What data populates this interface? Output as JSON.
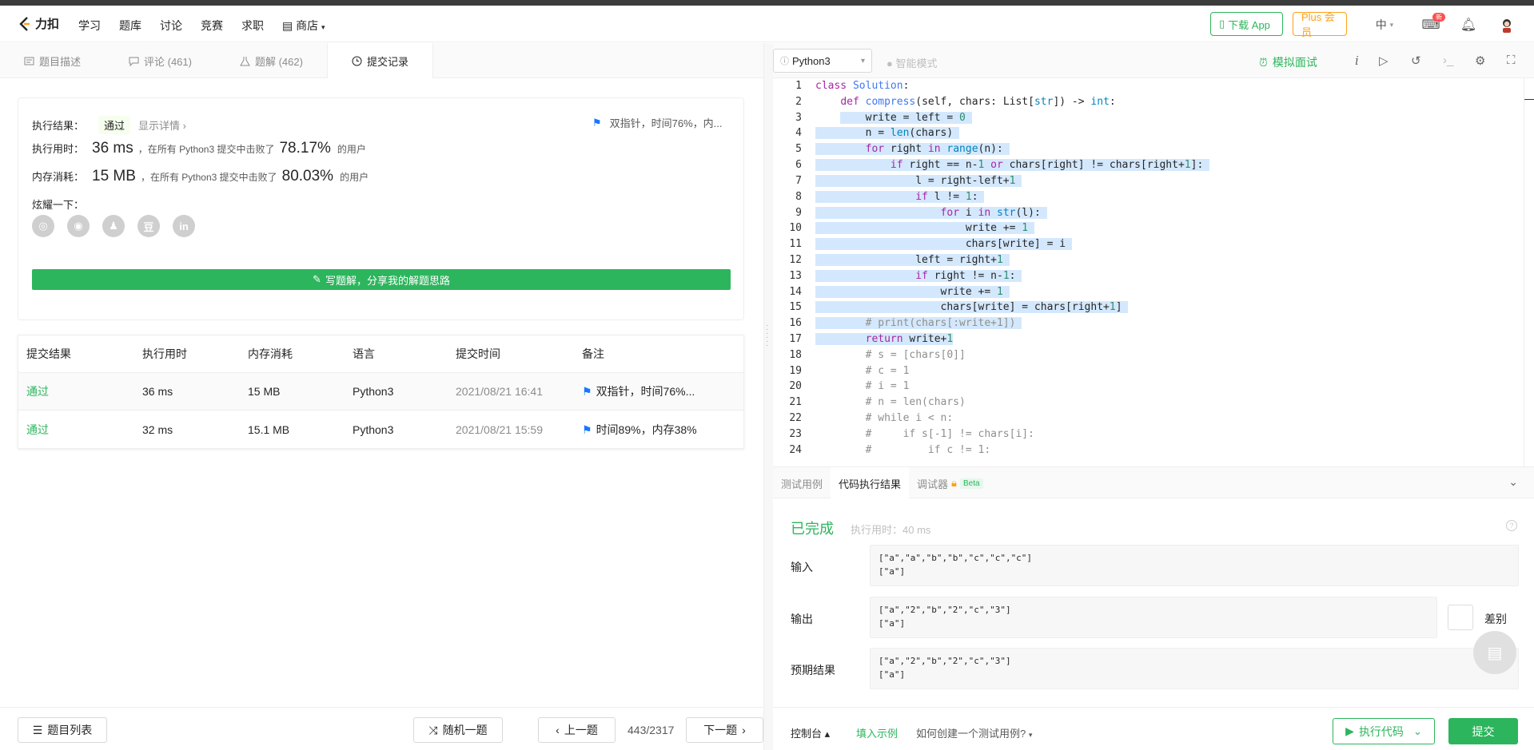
{
  "nav": {
    "logo": "力扣",
    "links": [
      "学习",
      "题库",
      "讨论",
      "竞赛",
      "求职",
      "商店"
    ],
    "download_app": "下载 App",
    "plus": "Plus 会员",
    "lang": "中",
    "badge": "新"
  },
  "tabs": [
    {
      "label": "题目描述"
    },
    {
      "label": "评论 (461)"
    },
    {
      "label": "题解 (462)"
    },
    {
      "label": "提交记录"
    }
  ],
  "result": {
    "status_label": "执行结果：",
    "status_value": "通过",
    "details_link": "显示详情 ›",
    "note": "双指针，时间76%，内...",
    "time_label": "执行用时：",
    "time_value": "36 ms",
    "time_desc": "，在所有 Python3 提交中击败了",
    "time_pct": "78.17%",
    "users": "的用户",
    "mem_label": "内存消耗：",
    "mem_value": "15 MB",
    "mem_desc": "，在所有 Python3 提交中击败了",
    "mem_pct": "80.03%",
    "share_label": "炫耀一下：",
    "share_icons": [
      "wechat-icon",
      "weibo-icon",
      "qq-icon",
      "douban-icon",
      "linkedin-icon"
    ],
    "douban_glyph": "豆",
    "linkedin_glyph": "in",
    "write_button": "写题解，分享我的解题思路"
  },
  "table": {
    "headers": [
      "提交结果",
      "执行用时",
      "内存消耗",
      "语言",
      "提交时间",
      "备注"
    ],
    "rows": [
      {
        "result": "通过",
        "time": "36 ms",
        "memory": "15 MB",
        "lang": "Python3",
        "submitted": "2021/08/21 16:41",
        "note": "双指针，时间76%..."
      },
      {
        "result": "通过",
        "time": "32 ms",
        "memory": "15.1 MB",
        "lang": "Python3",
        "submitted": "2021/08/21 15:59",
        "note": "时间89%，内存38%"
      }
    ]
  },
  "bottom": {
    "problem_list": "题目列表",
    "random": "随机一题",
    "prev": "上一题",
    "page": "443/2317",
    "next": "下一题"
  },
  "editor": {
    "language": "Python3",
    "smart_mode": "智能模式",
    "mock_interview": "模拟面试"
  },
  "console": {
    "tabs": [
      "测试用例",
      "代码执行结果",
      "调试器"
    ],
    "beta": "Beta",
    "status": "已完成",
    "runtime": "执行用时：40 ms",
    "input_label": "输入",
    "input_value": "[\"a\",\"a\",\"b\",\"b\",\"c\",\"c\",\"c\"]\n[\"a\"]",
    "output_label": "输出",
    "output_value": "[\"a\",\"2\",\"b\",\"2\",\"c\",\"3\"]\n[\"a\"]",
    "expected_label": "预期结果",
    "expected_value": "[\"a\",\"2\",\"b\",\"2\",\"c\",\"3\"]\n[\"a\"]",
    "diff_label": "差别",
    "console_label": "控制台 ▴",
    "fill_example": "填入示例",
    "howto": "如何创建一个测试用例?",
    "run": "执行代码",
    "submit": "提交"
  }
}
